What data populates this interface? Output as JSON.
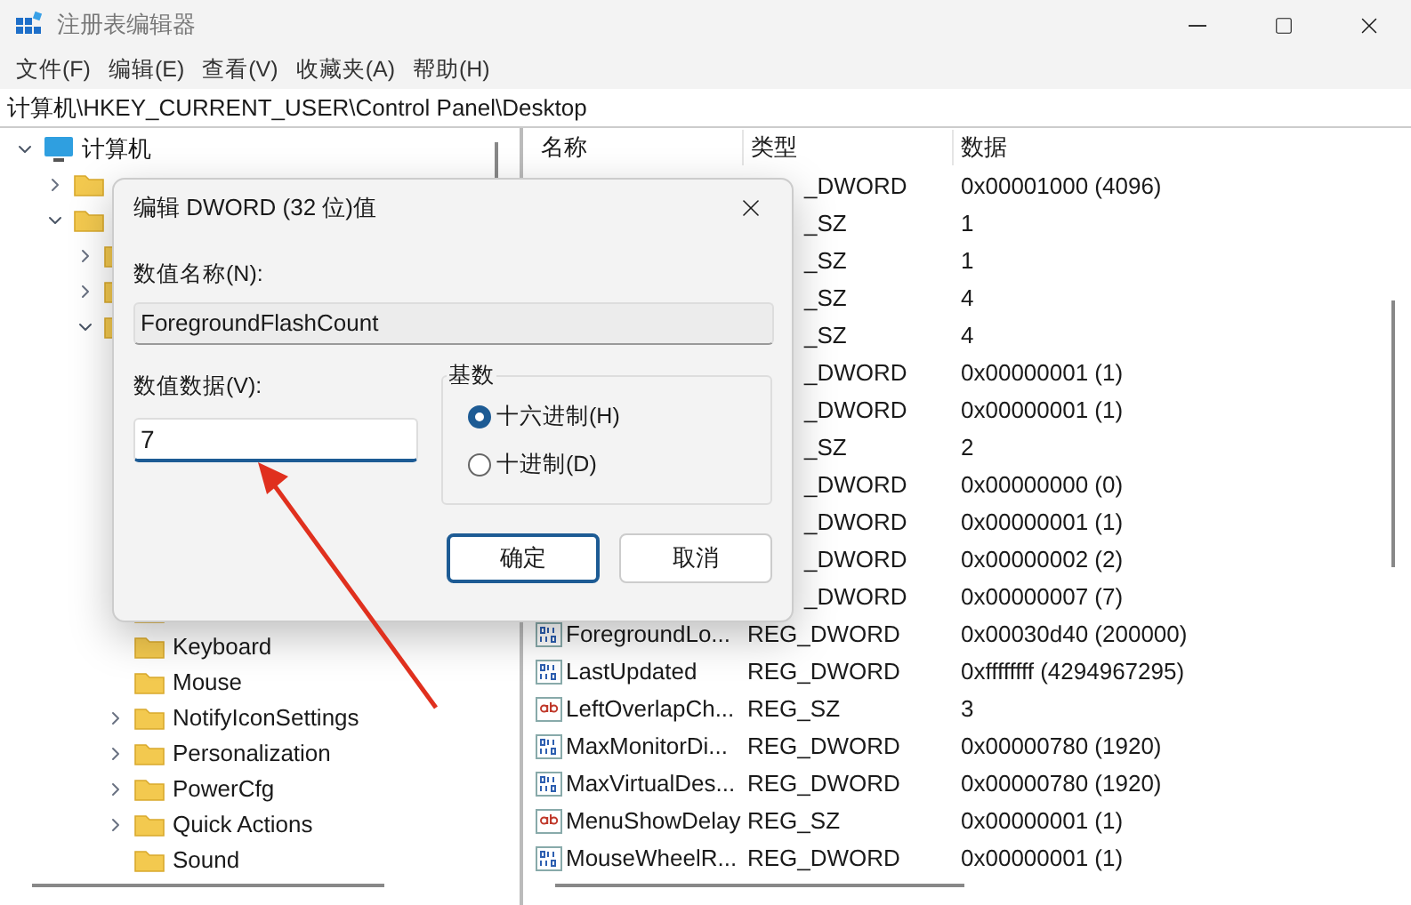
{
  "window": {
    "title": "注册表编辑器"
  },
  "menu": [
    "文件(F)",
    "编辑(E)",
    "查看(V)",
    "收藏夹(A)",
    "帮助(H)"
  ],
  "address": "计算机\\HKEY_CURRENT_USER\\Control Panel\\Desktop",
  "tree": [
    {
      "kind": "computer",
      "label": "计算机",
      "expanded": true,
      "children": [
        {
          "kind": "branch",
          "expanded": false
        },
        {
          "kind": "branch",
          "expanded": true,
          "children": [
            {
              "kind": "branch",
              "expanded": false
            },
            {
              "kind": "branch",
              "expanded": false
            },
            {
              "kind": "branch",
              "expanded": true,
              "children": [
                {
                  "kind": "folder"
                },
                {
                  "kind": "folder"
                },
                {
                  "kind": "folder"
                },
                {
                  "kind": "folder"
                },
                {
                  "kind": "folder"
                },
                {
                  "kind": "folder"
                },
                {
                  "kind": "folder"
                },
                {
                  "kind": "folder"
                },
                {
                  "kind": "leaf",
                  "label": "Keyboard"
                },
                {
                  "kind": "leaf",
                  "label": "Mouse"
                },
                {
                  "kind": "branch",
                  "label": "NotifyIconSettings",
                  "expanded": false
                },
                {
                  "kind": "branch",
                  "label": "Personalization",
                  "expanded": false
                },
                {
                  "kind": "branch",
                  "label": "PowerCfg",
                  "expanded": false
                },
                {
                  "kind": "branch",
                  "label": "Quick Actions",
                  "expanded": false
                },
                {
                  "kind": "leaf",
                  "label": "Sound"
                }
              ]
            }
          ]
        }
      ]
    }
  ],
  "table": {
    "columns": [
      "名称",
      "类型",
      "数据"
    ],
    "rows": [
      {
        "type": "_DWORD",
        "data": "0x00001000 (4096)"
      },
      {
        "type": "_SZ",
        "data": "1"
      },
      {
        "type": "_SZ",
        "data": "1"
      },
      {
        "type": "_SZ",
        "data": "4"
      },
      {
        "type": "_SZ",
        "data": "4"
      },
      {
        "type": "_DWORD",
        "data": "0x00000001 (1)"
      },
      {
        "type": "_DWORD",
        "data": "0x00000001 (1)"
      },
      {
        "type": "_SZ",
        "data": "2"
      },
      {
        "type": "_DWORD",
        "data": "0x00000000 (0)"
      },
      {
        "type": "_DWORD",
        "data": "0x00000001 (1)"
      },
      {
        "type": "_DWORD",
        "data": "0x00000002 (2)"
      },
      {
        "type": "_DWORD",
        "data": "0x00000007 (7)"
      },
      {
        "kind": "dword",
        "name": "ForegroundLo...",
        "type": "REG_DWORD",
        "data": "0x00030d40 (200000)"
      },
      {
        "kind": "dword",
        "name": "LastUpdated",
        "type": "REG_DWORD",
        "data": "0xffffffff (4294967295)"
      },
      {
        "kind": "string",
        "name": "LeftOverlapCh...",
        "type": "REG_SZ",
        "data": "3"
      },
      {
        "kind": "dword",
        "name": "MaxMonitorDi...",
        "type": "REG_DWORD",
        "data": "0x00000780 (1920)"
      },
      {
        "kind": "dword",
        "name": "MaxVirtualDes...",
        "type": "REG_DWORD",
        "data": "0x00000780 (1920)"
      },
      {
        "kind": "string",
        "name": "MenuShowDelay",
        "type": "REG_SZ",
        "data": "0x00000001 (1)"
      },
      {
        "kind": "dword",
        "name": "MouseWheelR...",
        "type": "REG_DWORD",
        "data": "0x00000001 (1)"
      }
    ]
  },
  "dialog": {
    "title": "编辑 DWORD (32 位)值",
    "name_label": "数值名称(N):",
    "name_value": "ForegroundFlashCount",
    "data_label": "数值数据(V):",
    "data_value": "7",
    "base_label": "基数",
    "bases": [
      {
        "label": "十六进制(H)",
        "selected": true
      },
      {
        "label": "十进制(D)",
        "selected": false
      }
    ],
    "ok": "确定",
    "cancel": "取消"
  }
}
